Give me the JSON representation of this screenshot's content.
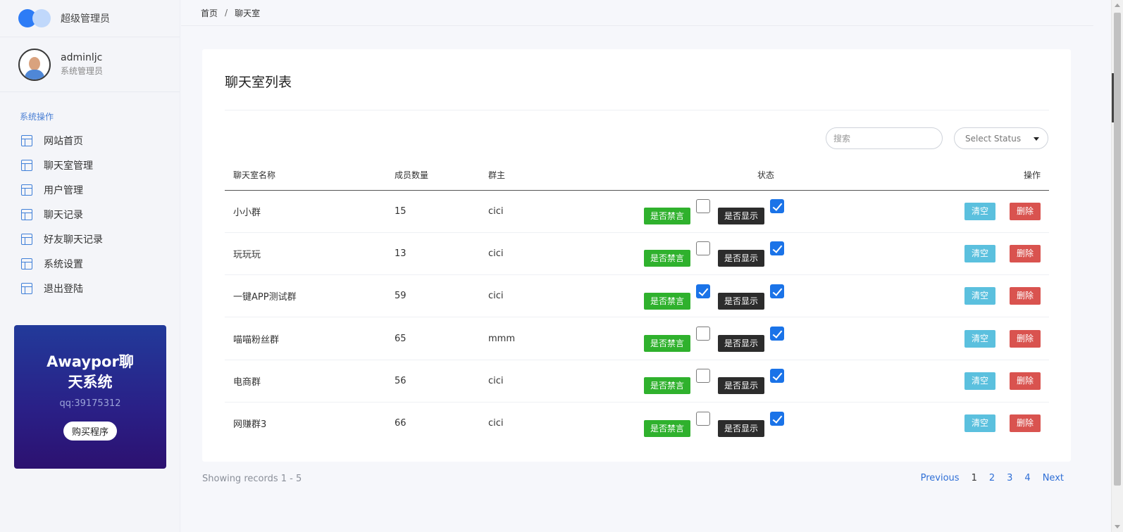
{
  "sidebar": {
    "brand_title": "超级管理员",
    "user_name": "adminljc",
    "user_role": "系统管理员",
    "section_title": "系统操作",
    "items": [
      {
        "label": "网站首页",
        "icon": "layout-icon"
      },
      {
        "label": "聊天室管理",
        "icon": "layout-icon"
      },
      {
        "label": "用户管理",
        "icon": "layout-icon"
      },
      {
        "label": "聊天记录",
        "icon": "layout-icon"
      },
      {
        "label": "好友聊天记录",
        "icon": "layout-icon"
      },
      {
        "label": "系统设置",
        "icon": "layout-icon"
      },
      {
        "label": "退出登陆",
        "icon": "layout-icon"
      }
    ],
    "promo": {
      "title": "Awaypor聊天系统",
      "qq": "qq:39175312",
      "button": "购买程序"
    }
  },
  "breadcrumb": {
    "home": "首页",
    "sep": "/",
    "current": "聊天室"
  },
  "card": {
    "title": "聊天室列表",
    "search_placeholder": "搜索",
    "select_value": "Select Status"
  },
  "table": {
    "headers": {
      "name": "聊天室名称",
      "count": "成员数量",
      "owner": "群主",
      "status": "状态",
      "ops": "操作"
    },
    "badge_mute": "是否禁言",
    "badge_show": "是否显示",
    "btn_clear": "清空",
    "btn_delete": "删除",
    "rows": [
      {
        "name": "小小群",
        "count": "15",
        "owner": "cici",
        "muted": false,
        "shown": true
      },
      {
        "name": "玩玩玩",
        "count": "13",
        "owner": "cici",
        "muted": false,
        "shown": true
      },
      {
        "name": "一键APP测试群",
        "count": "59",
        "owner": "cici",
        "muted": true,
        "shown": true
      },
      {
        "name": "喵喵粉丝群",
        "count": "65",
        "owner": "mmm",
        "muted": false,
        "shown": true
      },
      {
        "name": "电商群",
        "count": "56",
        "owner": "cici",
        "muted": false,
        "shown": true
      },
      {
        "name": "网赚群3",
        "count": "66",
        "owner": "cici",
        "muted": false,
        "shown": true
      }
    ]
  },
  "footer": {
    "records": "Showing records 1 - 5",
    "previous": "Previous",
    "pages": [
      "1",
      "2",
      "3",
      "4"
    ],
    "current_page": "1",
    "next": "Next"
  },
  "colors": {
    "accent": "#2d7cf6",
    "mute_badge": "#2fb12d",
    "show_badge": "#2c2c2c",
    "clear_btn": "#5bc0de",
    "delete_btn": "#d9534f"
  }
}
